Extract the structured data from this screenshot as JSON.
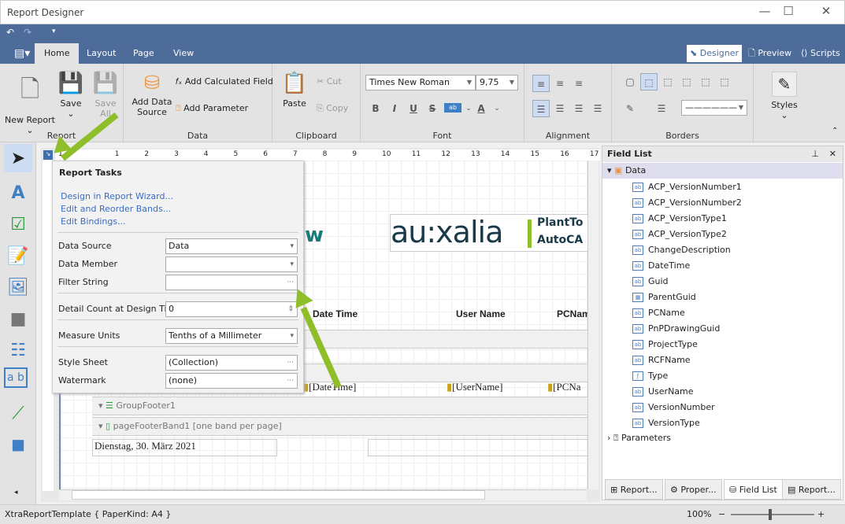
{
  "window": {
    "title": "Report Designer"
  },
  "tabs": [
    {
      "label": "Home"
    },
    {
      "label": "Layout"
    },
    {
      "label": "Page"
    },
    {
      "label": "View"
    }
  ],
  "views": [
    {
      "label": "Designer"
    },
    {
      "label": "Preview"
    },
    {
      "label": "Scripts"
    }
  ],
  "ribbon": {
    "report": {
      "label": "Report",
      "new_report": "New Report",
      "save": "Save",
      "save_all": "Save All"
    },
    "data": {
      "label": "Data",
      "add_data_source": "Add Data Source",
      "add_calculated_field": "Add Calculated Field",
      "add_parameter": "Add Parameter"
    },
    "clipboard": {
      "label": "Clipboard",
      "paste": "Paste",
      "cut": "Cut",
      "copy": "Copy"
    },
    "font": {
      "label": "Font",
      "family": "Times New Roman",
      "size": "9,75"
    },
    "alignment": {
      "label": "Alignment"
    },
    "borders": {
      "label": "Borders"
    },
    "styles": {
      "label": "Styles"
    }
  },
  "ruler": [
    "1",
    "1",
    "2",
    "3",
    "4",
    "5",
    "6",
    "7",
    "8",
    "9",
    "10",
    "11",
    "12",
    "13",
    "14",
    "15",
    "16",
    "17"
  ],
  "report": {
    "headers": [
      "Date Time",
      "User Name",
      "PCNam"
    ],
    "fields": [
      "[DateTime]",
      "[UserName]",
      "[PCNa"
    ],
    "logo": "au:xalia",
    "logo_text1": "PlantTo",
    "logo_text2": "AutoCA",
    "logo_partial": "w",
    "group_footer": "GroupFooter1",
    "page_footer": "pageFooterBand1 [one band per page]",
    "date": "Dienstag, 30. März 2021"
  },
  "tasks": {
    "title": "Report Tasks",
    "links": [
      "Design in Report Wizard...",
      "Edit and Reorder Bands...",
      "Edit Bindings..."
    ],
    "props": [
      {
        "label": "Data Source",
        "value": "Data",
        "btn": "▾"
      },
      {
        "label": "Data Member",
        "value": "",
        "btn": "▾"
      },
      {
        "label": "Filter String",
        "value": "",
        "btn": "···"
      },
      {
        "label": "Detail Count at Design Time",
        "value": "0",
        "btn": "⇕"
      },
      {
        "label": "Measure Units",
        "value": "Tenths of a Millimeter",
        "btn": "▾"
      },
      {
        "label": "Style Sheet",
        "value": "(Collection)",
        "btn": "···"
      },
      {
        "label": "Watermark",
        "value": "(none)",
        "btn": "···"
      }
    ]
  },
  "field_list": {
    "title": "Field List",
    "root": "Data",
    "fields": [
      {
        "name": "ACP_VersionNumber1",
        "icon": "ab"
      },
      {
        "name": "ACP_VersionNumber2",
        "icon": "ab"
      },
      {
        "name": "ACP_VersionType1",
        "icon": "ab"
      },
      {
        "name": "ACP_VersionType2",
        "icon": "ab"
      },
      {
        "name": "ChangeDescription",
        "icon": "ab"
      },
      {
        "name": "DateTime",
        "icon": "ab"
      },
      {
        "name": "Guid",
        "icon": "ab"
      },
      {
        "name": "ParentGuid",
        "icon": "table"
      },
      {
        "name": "PCName",
        "icon": "ab"
      },
      {
        "name": "PnPDrawingGuid",
        "icon": "ab"
      },
      {
        "name": "ProjectType",
        "icon": "ab"
      },
      {
        "name": "RCFName",
        "icon": "ab"
      },
      {
        "name": "Type",
        "icon": "f"
      },
      {
        "name": "UserName",
        "icon": "ab"
      },
      {
        "name": "VersionNumber",
        "icon": "ab"
      },
      {
        "name": "VersionType",
        "icon": "ab"
      }
    ],
    "parameters": "Parameters",
    "bottom_tabs": [
      "Report...",
      "Proper...",
      "Field List",
      "Report..."
    ]
  },
  "status": {
    "text": "XtraReportTemplate { PaperKind: A4 }",
    "zoom": "100%"
  },
  "colors": {
    "accent": "#4d6c9a",
    "arrow": "#8ebf2a",
    "link": "#3a6cc4"
  }
}
